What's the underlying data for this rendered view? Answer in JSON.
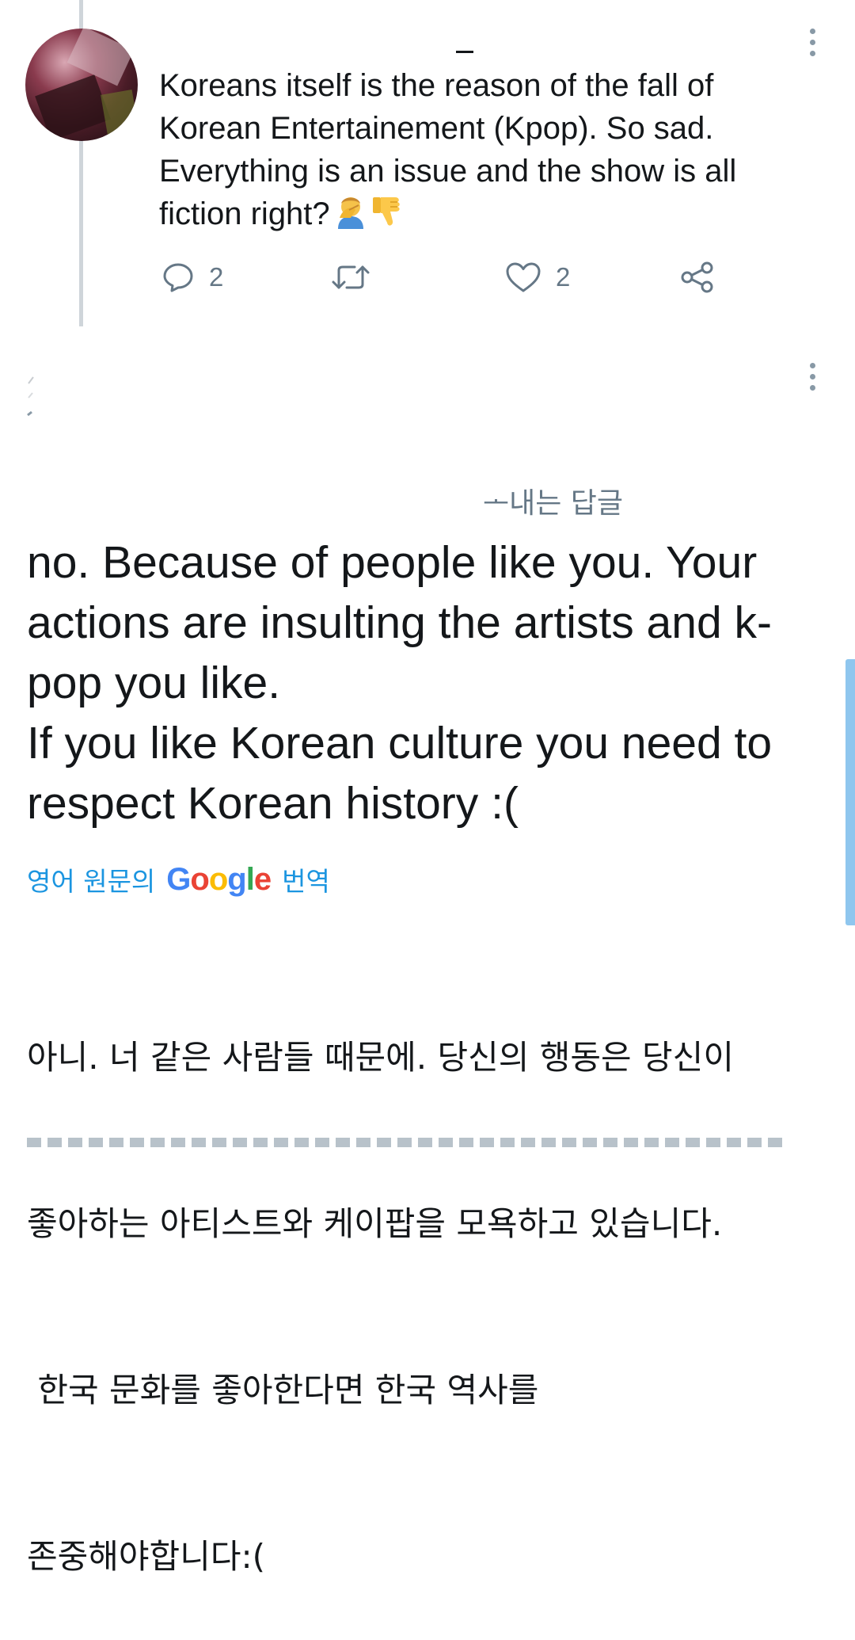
{
  "tweet1": {
    "author_avatar": "profile-photo",
    "text_lines": [
      "Koreans itself is the reason of the fall of",
      "Korean Entertainement (Kpop). So sad.",
      "Everything is an issue and the show is all",
      "fiction right?"
    ],
    "emojis": [
      "man-facepalming-emoji",
      "thumbs-down-emoji"
    ],
    "actions": {
      "reply_count": "2",
      "retweet_count": "",
      "like_count": "2"
    }
  },
  "tweet2": {
    "reply_label": "ᅩ내는 답글",
    "text_lines": [
      "no. Because of people like you. Your",
      "actions are insulting the artists and k-",
      "pop you like.",
      "If you like Korean culture you need to",
      "respect Korean history :("
    ],
    "translation": {
      "prefix": "영어 원문의",
      "provider": "Google",
      "suffix": "번역"
    },
    "translated_lines": [
      "아니. 너 같은 사람들 때문에. 당신의 행동은 당신이",
      "좋아하는 아티스트와 케이팝을 모욕하고 있습니다.",
      " 한국 문화를 좋아한다면 한국 역사를",
      "존중해야합니다:("
    ]
  },
  "colors": {
    "text": "#14171a",
    "muted": "#657786",
    "link": "#1b95e0",
    "thread_line": "#cfd5da"
  }
}
